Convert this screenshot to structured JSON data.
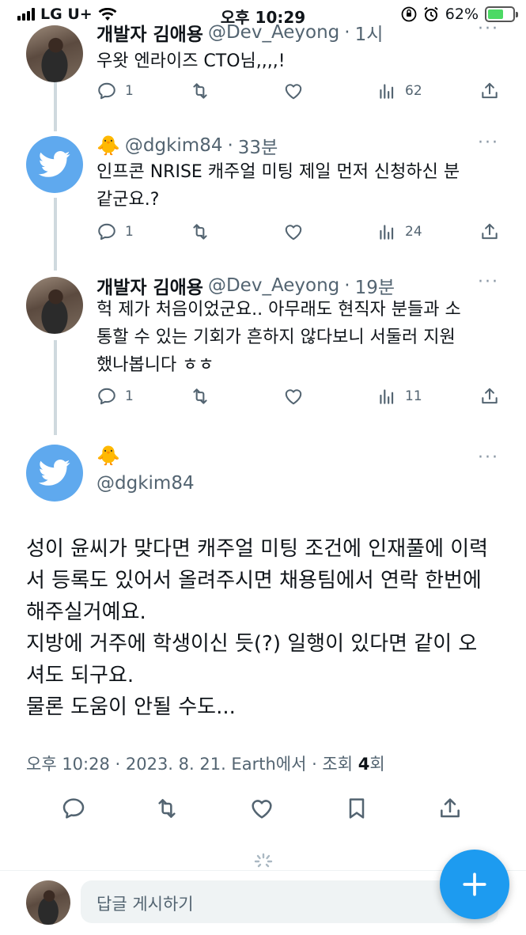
{
  "status_bar": {
    "carrier": "LG U+",
    "time": "오후 10:29",
    "battery": "62%",
    "battery_level": 0.62
  },
  "tweets": [
    {
      "name": "개발자 김애용",
      "handle": "@Dev_Aeyong",
      "dot": "·",
      "time": "1시",
      "lines": [
        "우왓 엔라이즈 CTO님,,,,!"
      ],
      "replies": "1",
      "views": "62"
    },
    {
      "name": "🐥",
      "handle": "@dgkim84",
      "dot": "·",
      "time": "33분",
      "lines": [
        "인프콘 NRISE 캐주얼 미팅 제일 먼저 신청하신 분",
        "같군요.?"
      ],
      "replies": "1",
      "views": "24"
    },
    {
      "name": "개발자 김애용",
      "handle": "@Dev_Aeyong",
      "dot": "·",
      "time": "19분",
      "lines": [
        "헉 제가 처음이었군요.. 아무래도 현직자 분들과 소",
        "통할 수 있는 기회가 흔하지 않다보니 서둘러 지원",
        "했나봅니다 ㅎㅎ"
      ],
      "replies": "1",
      "views": "11"
    }
  ],
  "main_tweet": {
    "name": "🐥",
    "handle": "@dgkim84",
    "lines": [
      "성이 윤씨가 맞다면 캐주얼 미팅 조건에 인재풀에 이력",
      "서 등록도 있어서 올려주시면 채용팀에서 연락 한번에",
      "해주실거예요.",
      "지방에 거주에 학생이신 듯(?) 일행이 있다면 같이 오",
      "셔도 되구요.",
      "물론 도움이 안될 수도..."
    ],
    "meta_prefix": "오후 10:28 · 2023. 8. 21. Earth에서 · 조회 ",
    "views_count": "4",
    "meta_suffix": "회"
  },
  "reply_bar": {
    "placeholder": "답글 게시하기"
  },
  "colors": {
    "accent": "#1d9bf0",
    "twitter_avatar": "#5fa9ee",
    "muted": "#536471",
    "thread_line": "#cfd9de"
  }
}
